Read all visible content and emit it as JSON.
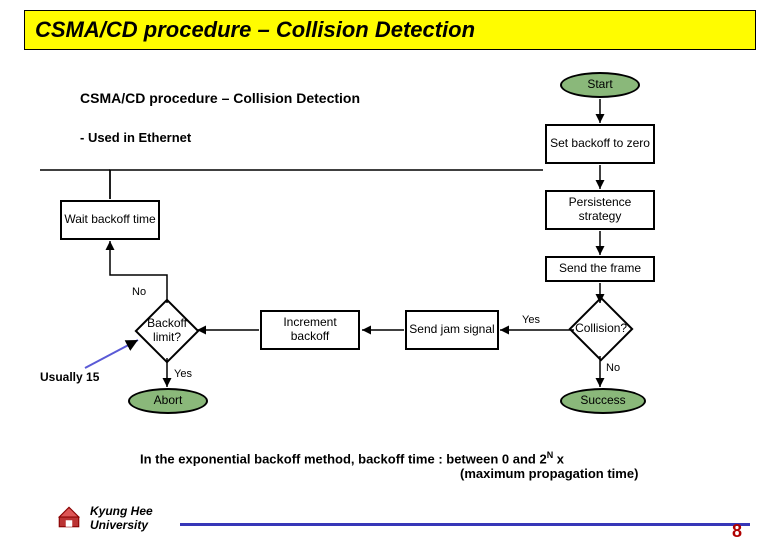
{
  "title": "CSMA/CD procedure – Collision Detection",
  "subtitle": "CSMA/CD procedure – Collision Detection",
  "note_used_in": "- Used in Ethernet",
  "annotation_usually": "Usually 15",
  "caption_line1": "In the exponential backoff method, backoff time : between 0 and 2",
  "caption_exp": "N",
  "caption_line1b": " x",
  "caption_line2": "(maximum propagation time)",
  "university": "Kyung Hee University",
  "page_number": "8",
  "flow": {
    "start": "Start",
    "set_backoff_zero": "Set backoff to zero",
    "persistence_strategy": "Persistence strategy",
    "send_frame": "Send the frame",
    "collision_q": "Collision?",
    "success": "Success",
    "send_jam": "Send jam signal",
    "increment_backoff": "Increment backoff",
    "backoff_limit_q": "Backoff limit?",
    "wait_backoff": "Wait backoff time",
    "abort": "Abort"
  },
  "labels": {
    "yes": "Yes",
    "no": "No"
  },
  "chart_data": {
    "type": "flowchart",
    "title": "CSMA/CD procedure – Collision Detection",
    "nodes": [
      {
        "id": "start",
        "type": "terminal",
        "label": "Start"
      },
      {
        "id": "set_backoff_zero",
        "type": "process",
        "label": "Set backoff to zero"
      },
      {
        "id": "persistence_strategy",
        "type": "process",
        "label": "Persistence strategy"
      },
      {
        "id": "send_frame",
        "type": "process",
        "label": "Send the frame"
      },
      {
        "id": "collision",
        "type": "decision",
        "label": "Collision?"
      },
      {
        "id": "success",
        "type": "terminal",
        "label": "Success"
      },
      {
        "id": "send_jam",
        "type": "process",
        "label": "Send jam signal"
      },
      {
        "id": "increment_backoff",
        "type": "process",
        "label": "Increment backoff"
      },
      {
        "id": "backoff_limit",
        "type": "decision",
        "label": "Backoff limit?"
      },
      {
        "id": "wait_backoff",
        "type": "process",
        "label": "Wait backoff time"
      },
      {
        "id": "abort",
        "type": "terminal",
        "label": "Abort"
      }
    ],
    "edges": [
      {
        "from": "start",
        "to": "set_backoff_zero"
      },
      {
        "from": "set_backoff_zero",
        "to": "persistence_strategy"
      },
      {
        "from": "persistence_strategy",
        "to": "send_frame"
      },
      {
        "from": "send_frame",
        "to": "collision"
      },
      {
        "from": "collision",
        "to": "success",
        "label": "No"
      },
      {
        "from": "collision",
        "to": "send_jam",
        "label": "Yes"
      },
      {
        "from": "send_jam",
        "to": "increment_backoff"
      },
      {
        "from": "increment_backoff",
        "to": "backoff_limit"
      },
      {
        "from": "backoff_limit",
        "to": "wait_backoff",
        "label": "No"
      },
      {
        "from": "backoff_limit",
        "to": "abort",
        "label": "Yes"
      },
      {
        "from": "wait_backoff",
        "to": "persistence_strategy"
      }
    ],
    "annotations": [
      {
        "target": "backoff_limit",
        "text": "Usually 15"
      }
    ]
  }
}
